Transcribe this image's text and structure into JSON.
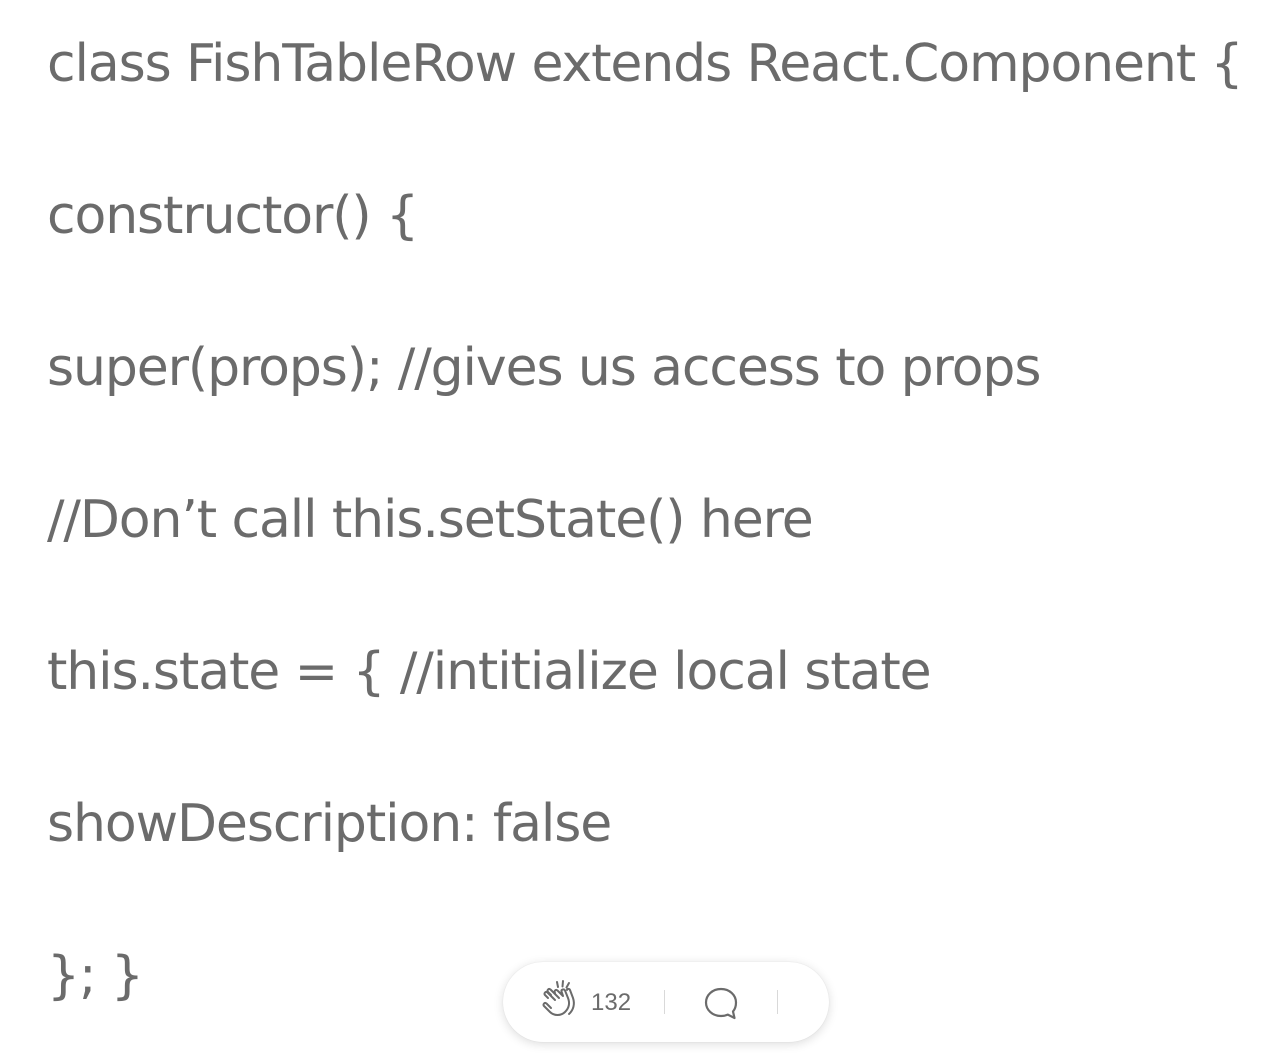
{
  "article": {
    "code_lines": [
      "class FishTableRow extends React.Component {",
      "constructor() {",
      "super(props); //gives us access to props",
      "//Don’t call this.setState() here",
      "this.state = { //intitialize local state",
      "showDescription: false",
      "}; }"
    ]
  },
  "action_bar": {
    "clap_icon": "clap-icon",
    "clap_count": "132",
    "comment_icon": "comment-icon"
  },
  "colors": {
    "text": "#6b6b6b",
    "background": "#ffffff",
    "divider": "#d9d9d9"
  }
}
